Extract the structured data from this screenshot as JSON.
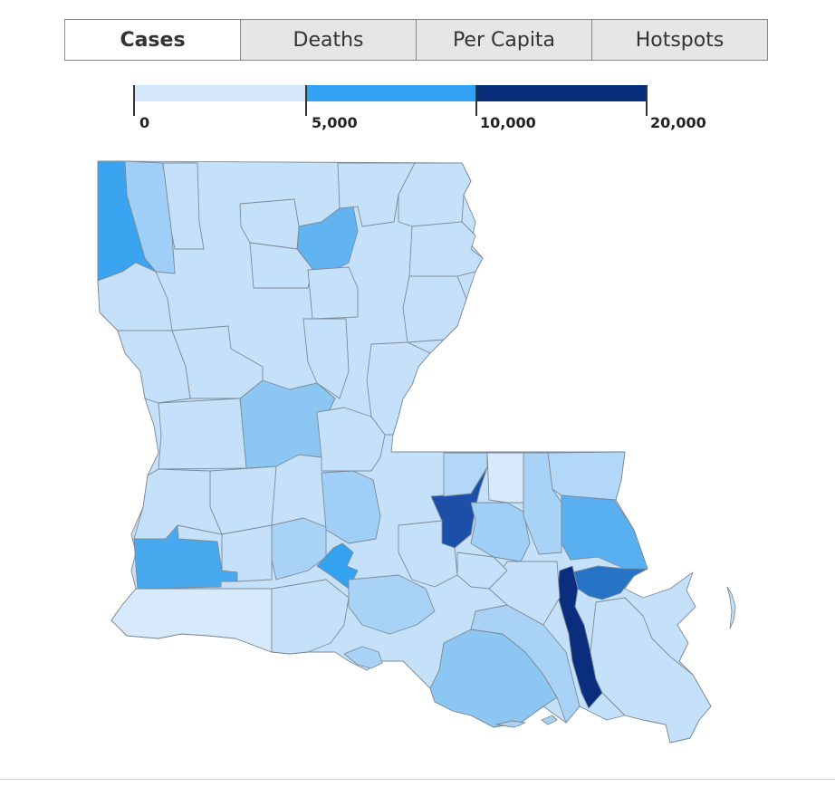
{
  "tabs": [
    {
      "label": "Cases",
      "active": true
    },
    {
      "label": "Deaths",
      "active": false
    },
    {
      "label": "Per Capita",
      "active": false
    },
    {
      "label": "Hotspots",
      "active": false
    }
  ],
  "legend": {
    "breaks": [
      "0",
      "5,000",
      "10,000",
      "20,000"
    ],
    "colors": [
      "#d4e8fa",
      "#33a2f2",
      "#072c7a"
    ]
  },
  "map": {
    "region": "Louisiana parishes",
    "colors": {
      "lightest": "#d6eafb",
      "light": "#c5e1f9",
      "light_medium": "#a9d3f6",
      "medium": "#8cc7f4",
      "medium_dark": "#58b0f0",
      "strong": "#33a2f2",
      "darker": "#1f6fc4",
      "darkest": "#0a2d7e"
    }
  }
}
